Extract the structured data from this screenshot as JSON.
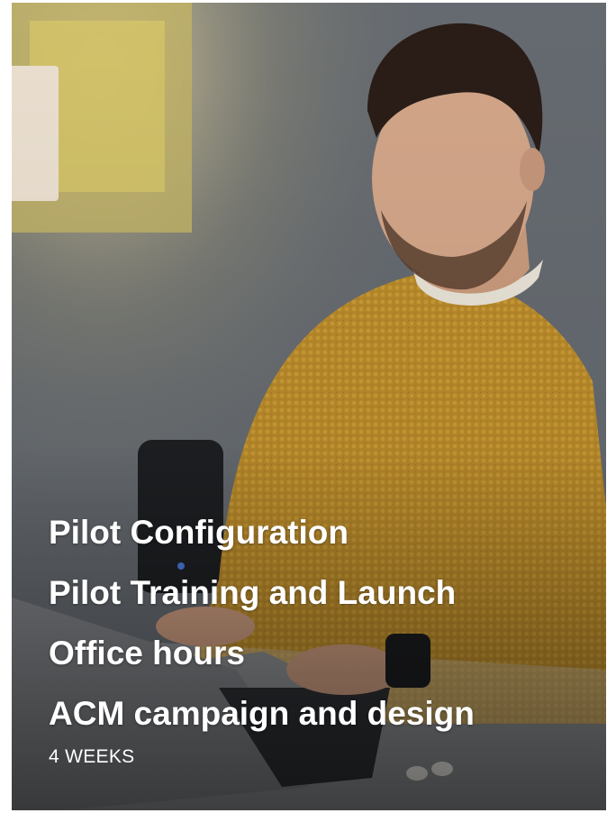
{
  "card": {
    "lines": [
      "Pilot Configuration",
      "Pilot Training and Launch",
      "Office hours",
      "ACM campaign and design"
    ],
    "duration": "4 WEEKS"
  },
  "colors": {
    "text": "#ffffff",
    "sweater": "#b8892a",
    "wall": "#6b7076"
  }
}
